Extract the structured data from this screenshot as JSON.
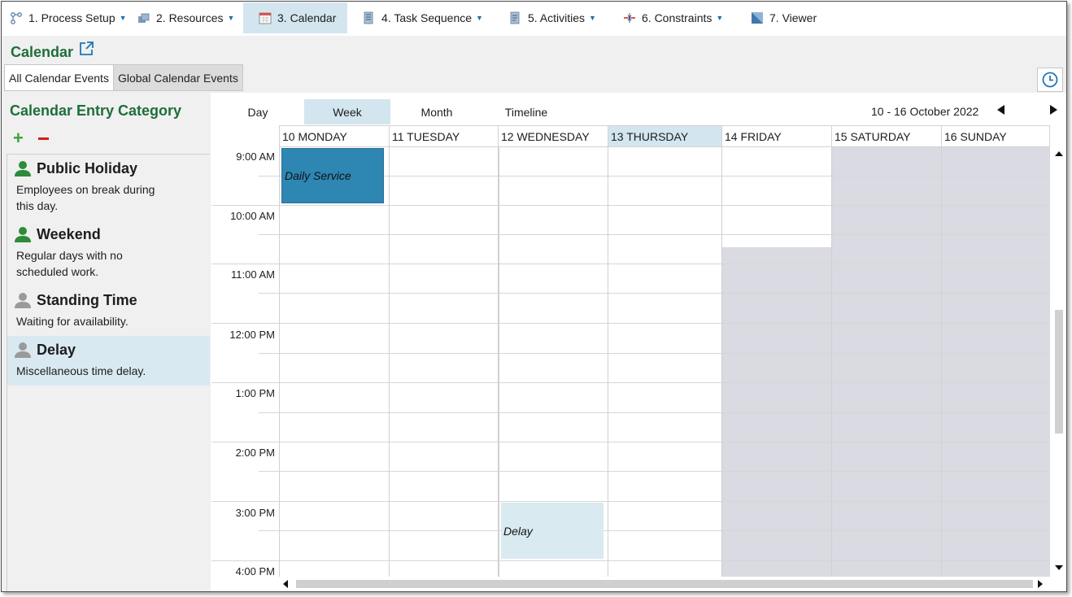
{
  "topnav": [
    {
      "label": "1. Process Setup",
      "icon": "process-setup-icon",
      "caret": true
    },
    {
      "label": "2. Resources",
      "icon": "resources-icon",
      "caret": true
    },
    {
      "label": "3. Calendar",
      "icon": "calendar-icon",
      "caret": false,
      "active": true
    },
    {
      "label": "4. Task Sequence",
      "icon": "task-sequence-icon",
      "caret": true
    },
    {
      "label": "5. Activities",
      "icon": "activities-icon",
      "caret": true
    },
    {
      "label": "6. Constraints",
      "icon": "constraints-icon",
      "caret": true
    },
    {
      "label": "7. Viewer",
      "icon": "viewer-icon",
      "caret": false
    }
  ],
  "header": {
    "title": "Calendar",
    "tabs": [
      "All Calendar Events",
      "Global Calendar Events"
    ]
  },
  "left_panel": {
    "title": "Calendar Entry Category",
    "categories": [
      {
        "name": "Public Holiday",
        "description": "Employees on break during this day.",
        "icon_color": "#2e8b3a"
      },
      {
        "name": "Weekend",
        "description": "Regular days with no scheduled work.",
        "icon_color": "#2e8b3a"
      },
      {
        "name": "Standing Time",
        "description": "Waiting for availability.",
        "icon_color": "#9a9a9a"
      },
      {
        "name": "Delay",
        "description": "Miscellaneous time delay.",
        "icon_color": "#9a9a9a",
        "selected": true
      }
    ]
  },
  "calendar": {
    "views": [
      "Day",
      "Week",
      "Month",
      "Timeline"
    ],
    "active_view": "Week",
    "date_range": "10  - 16 October 2022",
    "days": [
      "10 MONDAY",
      "11 TUESDAY",
      "12 WEDNESDAY",
      "13 THURSDAY",
      "14 FRIDAY",
      "15 SATURDAY",
      "16 SUNDAY"
    ],
    "today_index": 3,
    "times": [
      "9:00 AM",
      "10:00 AM",
      "11:00 AM",
      "12:00 PM",
      "1:00 PM",
      "2:00 PM",
      "3:00 PM",
      "4:00 PM"
    ],
    "events": [
      {
        "title": "Daily Service",
        "type": "service"
      },
      {
        "title": "Delay",
        "type": "delay"
      }
    ],
    "colors": {
      "accent": "#1e6e3c",
      "selected": "#d3e6ef",
      "non_working": "#d9dae2",
      "service_event": "#2e86b3"
    }
  }
}
